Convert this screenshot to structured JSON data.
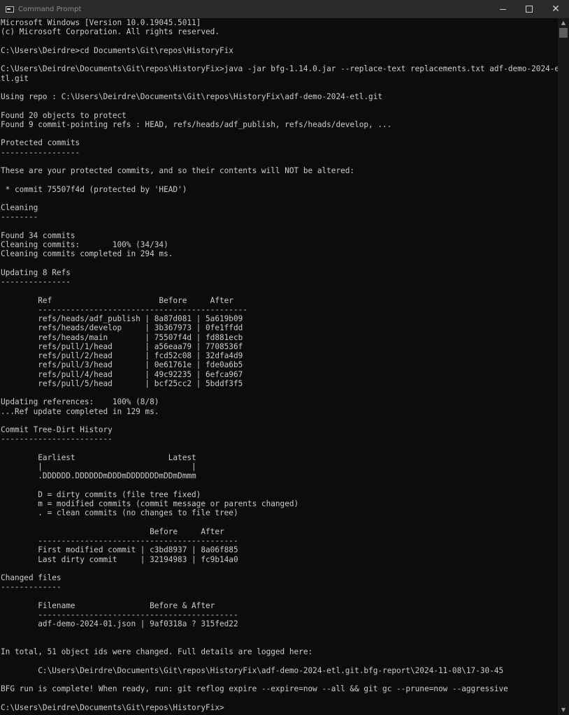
{
  "window": {
    "title": "Command Prompt",
    "icon": "console-icon",
    "controls": {
      "minimize": "minimize-icon",
      "maximize": "maximize-icon",
      "close": "✕"
    }
  },
  "console": {
    "lines": [
      "Microsoft Windows [Version 10.0.19045.5011]",
      "(c) Microsoft Corporation. All rights reserved.",
      "",
      "C:\\Users\\Deirdre>cd Documents\\Git\\repos\\HistoryFix",
      "",
      "C:\\Users\\Deirdre\\Documents\\Git\\repos\\HistoryFix>java -jar bfg-1.14.0.jar --replace-text replacements.txt adf-demo-2024-e",
      "tl.git",
      "",
      "Using repo : C:\\Users\\Deirdre\\Documents\\Git\\repos\\HistoryFix\\adf-demo-2024-etl.git",
      "",
      "Found 20 objects to protect",
      "Found 9 commit-pointing refs : HEAD, refs/heads/adf_publish, refs/heads/develop, ...",
      "",
      "Protected commits",
      "-----------------",
      "",
      "These are your protected commits, and so their contents will NOT be altered:",
      "",
      " * commit 75507f4d (protected by 'HEAD')",
      "",
      "Cleaning",
      "--------",
      "",
      "Found 34 commits",
      "Cleaning commits:       100% (34/34)",
      "Cleaning commits completed in 294 ms.",
      "",
      "Updating 8 Refs",
      "---------------",
      "",
      "        Ref                       Before     After",
      "        ---------------------------------------------",
      "        refs/heads/adf_publish | 8a87d081 | 5a619b09",
      "        refs/heads/develop     | 3b367973 | 0fe1ffdd",
      "        refs/heads/main        | 75507f4d | fd881ecb",
      "        refs/pull/1/head       | a56eaa79 | 7708536f",
      "        refs/pull/2/head       | fcd52c08 | 32dfa4d9",
      "        refs/pull/3/head       | 0e61761e | fde0a6b5",
      "        refs/pull/4/head       | 49c92235 | 6efca967",
      "        refs/pull/5/head       | bcf25cc2 | 5bddf3f5",
      "",
      "Updating references:    100% (8/8)",
      "...Ref update completed in 129 ms.",
      "",
      "Commit Tree-Dirt History",
      "------------------------",
      "",
      "        Earliest                    Latest",
      "        |                                |",
      "        .DDDDDD.DDDDDDmDDDmDDDDDDDmDDmDmmm",
      "",
      "        D = dirty commits (file tree fixed)",
      "        m = modified commits (commit message or parents changed)",
      "        . = clean commits (no changes to file tree)",
      "",
      "                                Before     After",
      "        -------------------------------------------",
      "        First modified commit | c3bd8937 | 8a06f885",
      "        Last dirty commit     | 32194983 | fc9b14a0",
      "",
      "Changed files",
      "-------------",
      "",
      "        Filename                Before & After",
      "        -------------------------------------------",
      "        adf-demo-2024-01.json | 9af0318a ? 315fed22",
      "",
      "",
      "In total, 51 object ids were changed. Full details are logged here:",
      "",
      "        C:\\Users\\Deirdre\\Documents\\Git\\repos\\HistoryFix\\adf-demo-2024-etl.git.bfg-report\\2024-11-08\\17-30-45",
      "",
      "BFG run is complete! When ready, run: git reflog expire --expire=now --all && git gc --prune=now --aggressive",
      "",
      "C:\\Users\\Deirdre\\Documents\\Git\\repos\\HistoryFix>"
    ]
  },
  "scrollbar": {
    "up": "▲",
    "down": "▼"
  }
}
